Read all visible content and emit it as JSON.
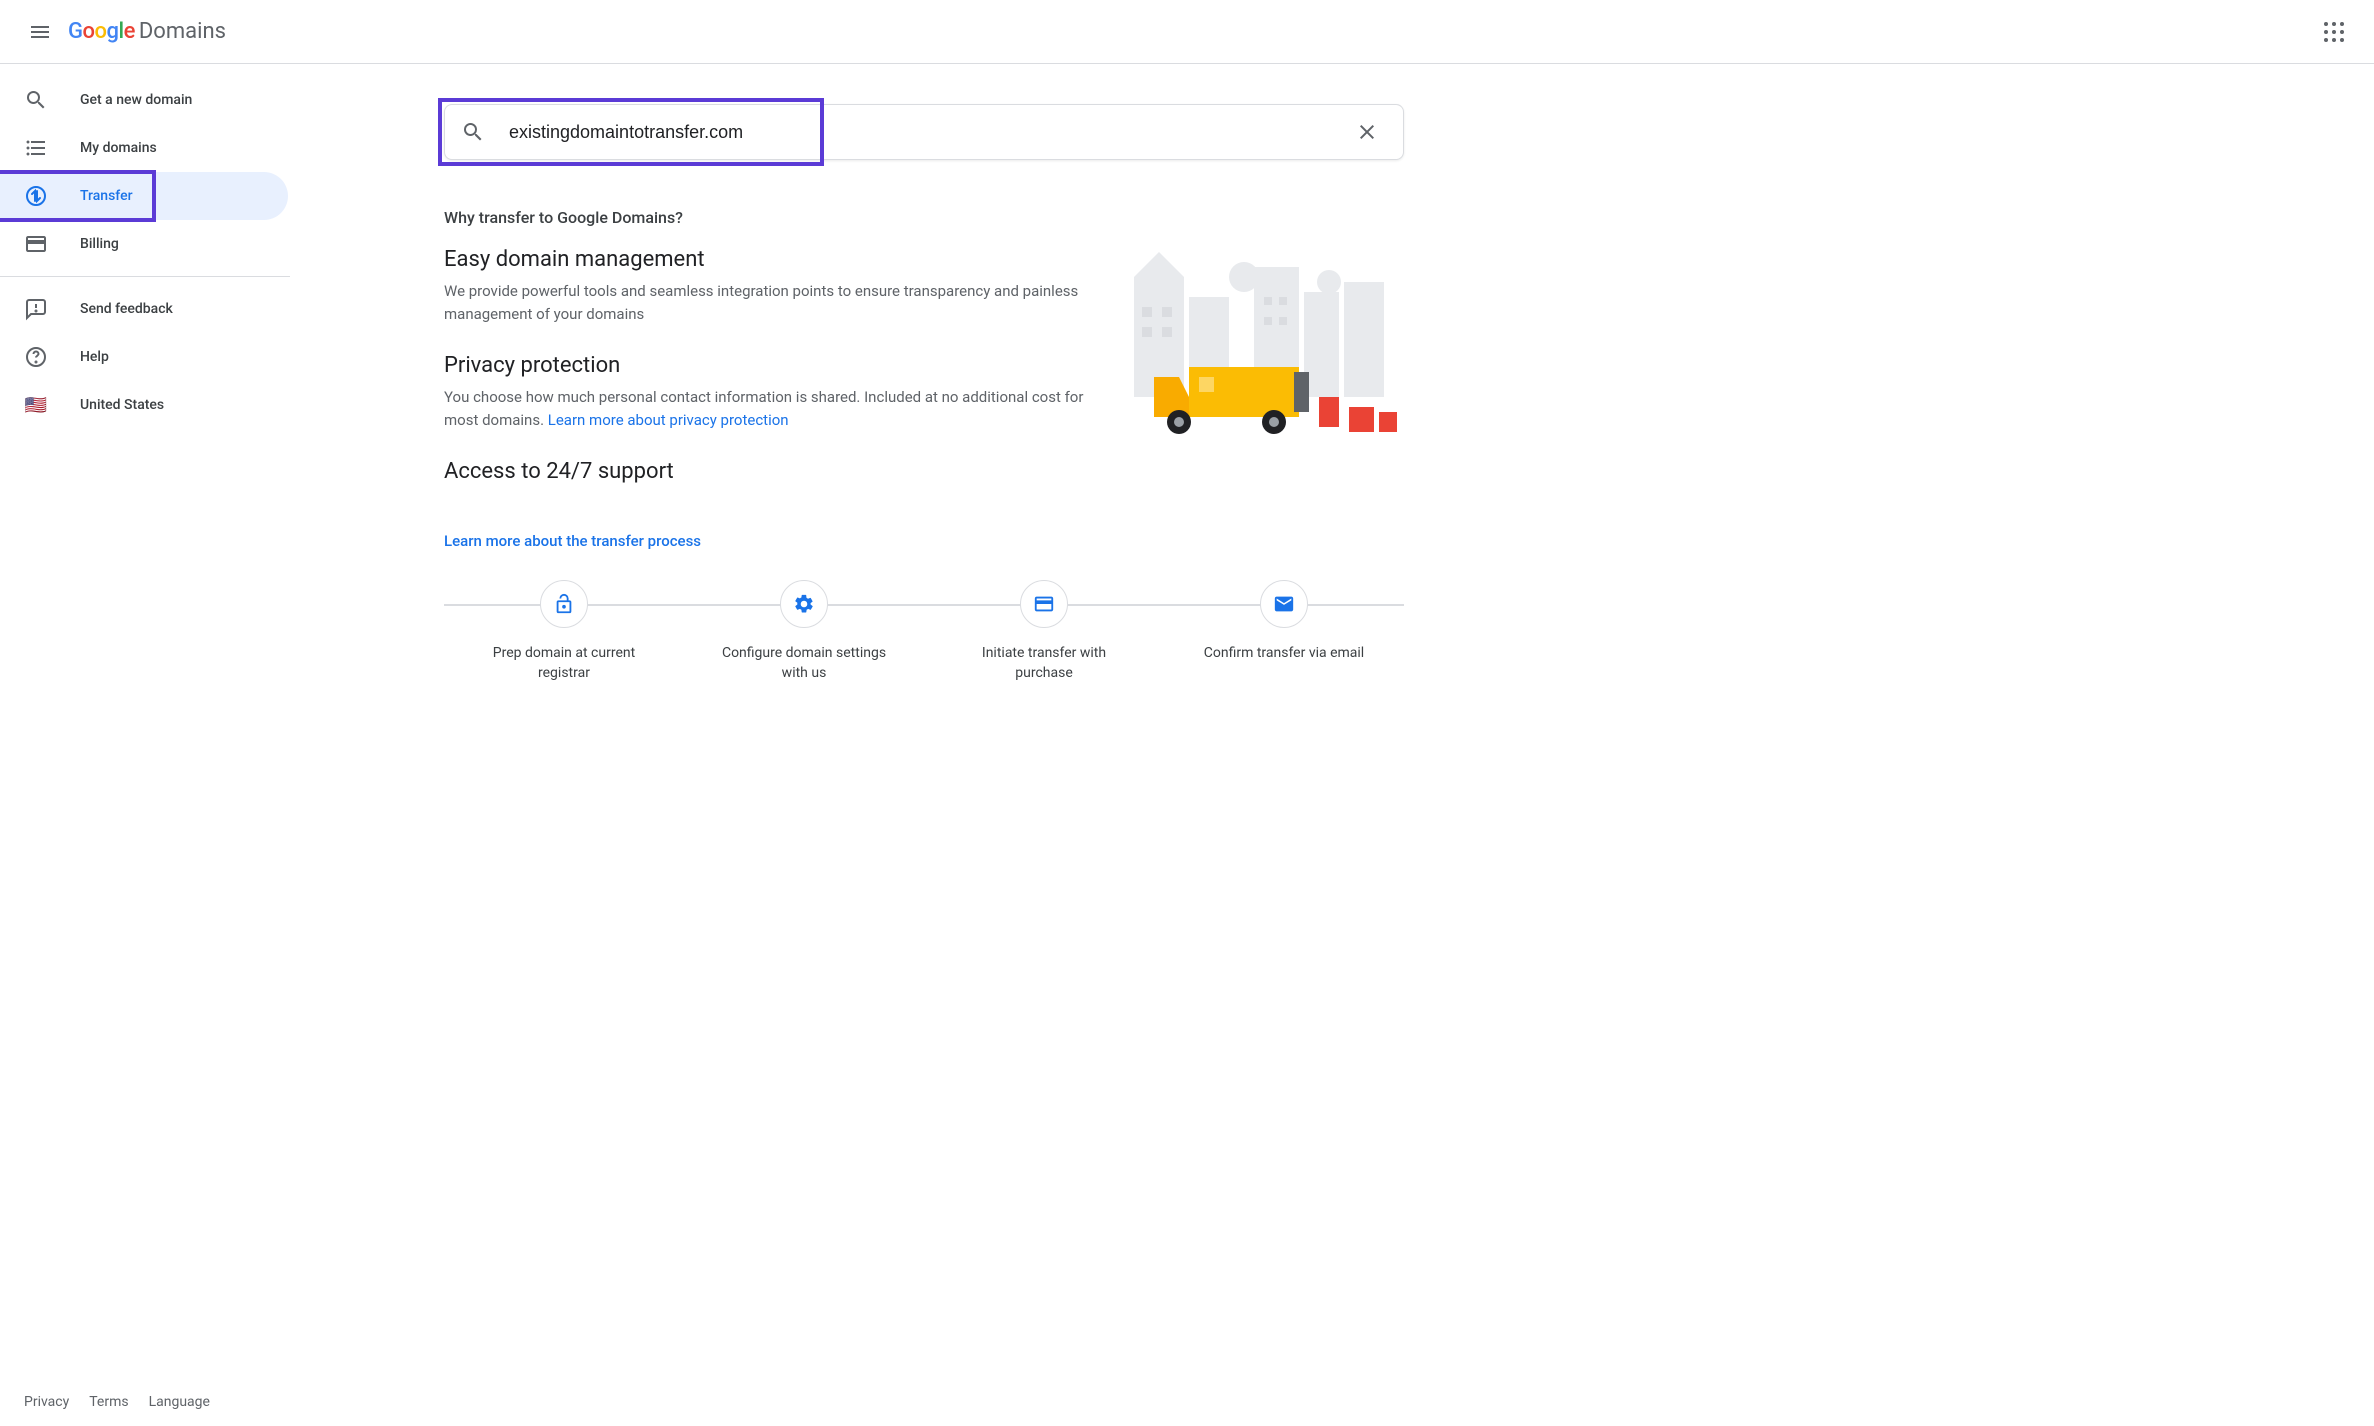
{
  "header": {
    "logo_product": "Domains"
  },
  "sidebar": {
    "items": [
      {
        "label": "Get a new domain",
        "icon": "search"
      },
      {
        "label": "My domains",
        "icon": "list"
      },
      {
        "label": "Transfer",
        "icon": "transfer"
      },
      {
        "label": "Billing",
        "icon": "billing"
      }
    ],
    "secondary": [
      {
        "label": "Send feedback",
        "icon": "feedback"
      },
      {
        "label": "Help",
        "icon": "help"
      },
      {
        "label": "United States",
        "icon": "flag"
      }
    ],
    "active_index": 2
  },
  "search": {
    "value": "existingdomaintotransfer.com"
  },
  "section": {
    "title": "Why transfer to Google Domains?",
    "features": [
      {
        "heading": "Easy domain management",
        "body": "We provide powerful tools and seamless integration points to ensure transparency and painless management of your domains"
      },
      {
        "heading": "Privacy protection",
        "body_prefix": "You choose how much personal contact information is shared. Included at no additional cost for most domains. ",
        "link_text": "Learn more about privacy protection"
      },
      {
        "heading": "Access to 24/7 support"
      }
    ],
    "learn_more": "Learn more about the transfer process",
    "steps": [
      {
        "label": "Prep domain at current registrar",
        "icon": "lock"
      },
      {
        "label": "Configure domain settings with us",
        "icon": "gear"
      },
      {
        "label": "Initiate transfer with purchase",
        "icon": "card"
      },
      {
        "label": "Confirm transfer via email",
        "icon": "mail"
      }
    ]
  },
  "footer": {
    "privacy": "Privacy",
    "terms": "Terms",
    "language": "Language"
  }
}
